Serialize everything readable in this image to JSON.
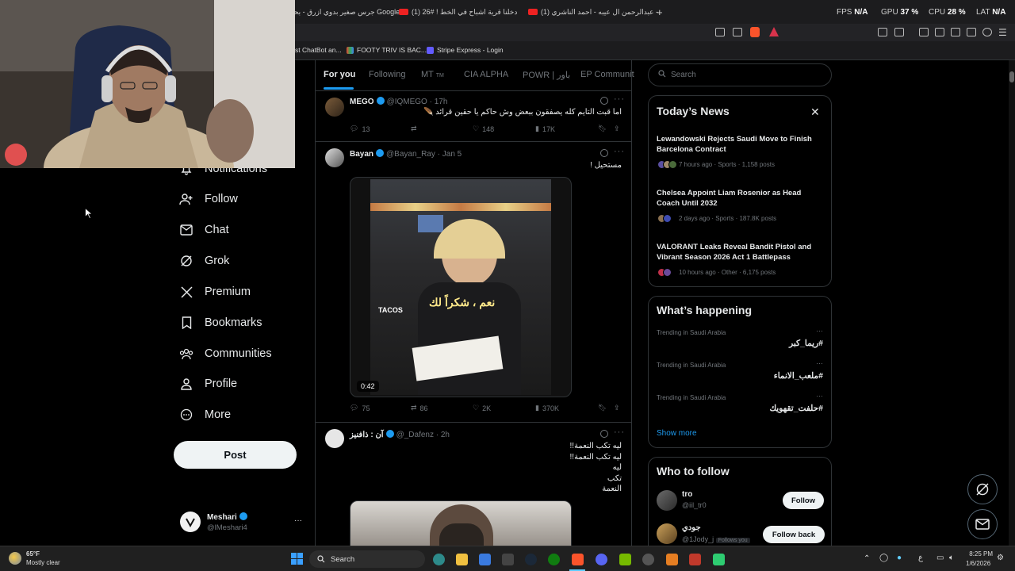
{
  "browser": {
    "tabs": [
      {
        "label": "جرس صغير بدوي ازرق - بحث Google"
      },
      {
        "label": "(1) دخلنا قرية اشباح في الخط ! #26"
      },
      {
        "label": "(1) عبدالرحمن ال عيبه - احمد الناشري -"
      }
    ],
    "new_tab": "+",
    "stats": {
      "fps_label": "FPS",
      "fps": "N/A",
      "gpu_label": "GPU",
      "gpu": "37 %",
      "cpu_label": "CPU",
      "cpu": "28 %",
      "lat_label": "LAT",
      "lat": "N/A"
    },
    "bookmarks": [
      {
        "label": "st ChatBot an...",
        "color": "#888888"
      },
      {
        "label": "FOOTY TRIV IS BAC...",
        "color": "#e0e0e0"
      },
      {
        "label": "Stripe Express - Login",
        "color": "#635bff"
      }
    ]
  },
  "nav": {
    "items": [
      {
        "label": "Notifications",
        "icon": "bell-icon"
      },
      {
        "label": "Follow",
        "icon": "follow-icon"
      },
      {
        "label": "Chat",
        "icon": "mail-icon"
      },
      {
        "label": "Grok",
        "icon": "grok-icon"
      },
      {
        "label": "Premium",
        "icon": "x-icon"
      },
      {
        "label": "Bookmarks",
        "icon": "bookmark-icon"
      },
      {
        "label": "Communities",
        "icon": "communities-icon"
      },
      {
        "label": "Profile",
        "icon": "profile-icon"
      },
      {
        "label": "More",
        "icon": "more-icon"
      }
    ],
    "post_button": "Post",
    "account": {
      "name": "Meshari",
      "handle": "@lMeshari4",
      "dots": "···"
    }
  },
  "feed": {
    "tabs": [
      {
        "label": "For you",
        "active": true
      },
      {
        "label": "Following"
      },
      {
        "label": "MT",
        "sub": "TM"
      },
      {
        "label": "CIA ALPHA"
      },
      {
        "label": "POWR | باور"
      },
      {
        "label": "EP Communit"
      }
    ],
    "posts": [
      {
        "name": "MEGO",
        "handle": "@IQMEGO",
        "time": "· 17h",
        "text": "اما قبت التايم كله يصفقون ببعض وش حاكم يا حقين قرائد 🪶",
        "replies": "13",
        "reposts": "",
        "likes": "148",
        "views": "17K"
      },
      {
        "name": "Bayan",
        "handle": "@Bayan_Ray",
        "time": "· Jan 5",
        "text": "مستحيل !",
        "video_caption": "نعم ، شكراً لك",
        "video_sign": "TACOS",
        "duration": "0:42",
        "replies": "75",
        "reposts": "86",
        "likes": "2K",
        "views": "370K"
      },
      {
        "name": "آن : ذافنيز",
        "handle": "@_Dafenz",
        "time": "· 2h",
        "lines": [
          "ليه تكب النعمة!!",
          "ليه تكب النعمة!!",
          "ليه",
          "تكب",
          "النعمة"
        ]
      }
    ]
  },
  "sidebar": {
    "search_placeholder": "Search",
    "news": {
      "title": "Today’s News",
      "items": [
        {
          "headline": "Lewandowski Rejects Saudi Move to Finish Barcelona Contract",
          "meta": "7 hours ago · Sports · 1,158 posts"
        },
        {
          "headline": "Chelsea Appoint Liam Rosenior as Head Coach Until 2032",
          "meta": "2 days ago · Sports · 187.8K posts"
        },
        {
          "headline": "VALORANT Leaks Reveal Bandit Pistol and Vibrant Season 2026 Act 1 Battlepass",
          "meta": "10 hours ago · Other · 6,175 posts"
        }
      ]
    },
    "happening": {
      "title": "What’s happening",
      "trends": [
        {
          "context": "Trending in Saudi Arabia",
          "tag": "#ريما_كبر"
        },
        {
          "context": "Trending in Saudi Arabia",
          "tag": "#ملعب_الانماء"
        },
        {
          "context": "Trending in Saudi Arabia",
          "tag": "#حلفت_تقهويك"
        }
      ],
      "show_more": "Show more"
    },
    "who_to_follow": {
      "title": "Who to follow",
      "users": [
        {
          "name": "tro",
          "handle": "@iil_tr0",
          "button": "Follow"
        },
        {
          "name": "جودي",
          "handle": "@1Jody_j",
          "badge": "Follows you",
          "button": "Follow back"
        }
      ]
    }
  },
  "taskbar": {
    "weather_temp": "65°F",
    "weather_desc": "Mostly clear",
    "search_label": "Search",
    "time": "8:25 PM",
    "date": "1/6/2026",
    "lang": "ع"
  },
  "colors": {
    "accent": "#1d9bf0",
    "bg": "#000000",
    "border": "#2f3336",
    "muted": "#71767b"
  }
}
